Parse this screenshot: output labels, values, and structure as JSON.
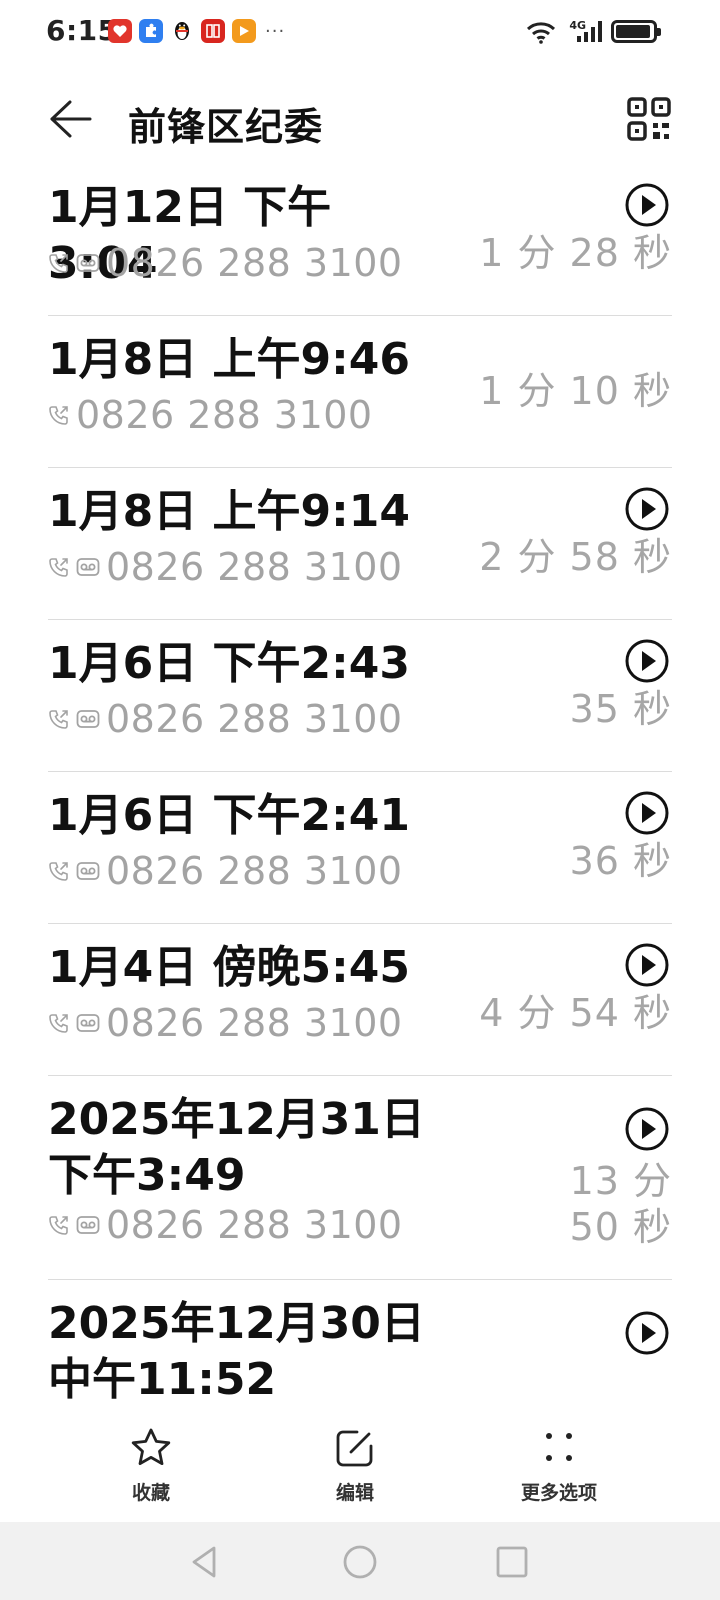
{
  "status_bar": {
    "time": "6:15",
    "network": "4G",
    "battery_level": 0.95,
    "notif_icons": [
      "health-app-icon",
      "puzzle-app-icon",
      "qq-penguin-icon",
      "news-app-icon",
      "video-app-icon"
    ],
    "more": "···"
  },
  "header": {
    "title": "前锋区纪委"
  },
  "calls": [
    {
      "date": "1月12日 下午3:04",
      "number": "0826 288 3100",
      "duration": "1 分 28 秒",
      "has_recording": true
    },
    {
      "date": "1月8日 上午9:46",
      "number": "0826 288 3100",
      "duration": "1 分 10 秒",
      "has_recording": false
    },
    {
      "date": "1月8日 上午9:14",
      "number": "0826 288 3100",
      "duration": "2 分 58 秒",
      "has_recording": true
    },
    {
      "date": "1月6日 下午2:43",
      "number": "0826 288 3100",
      "duration": "35 秒",
      "has_recording": true
    },
    {
      "date": "1月6日 下午2:41",
      "number": "0826 288 3100",
      "duration": "36 秒",
      "has_recording": true
    },
    {
      "date": "1月4日 傍晚5:45",
      "number": "0826 288 3100",
      "duration": "4 分 54 秒",
      "has_recording": true
    },
    {
      "date": "2025年12月31日 下午3:49",
      "number": "0826 288 3100",
      "duration": "13 分 50 秒",
      "has_recording": true
    },
    {
      "date": "2025年12月30日 中午11:52",
      "number": "",
      "duration": "",
      "has_recording": true
    }
  ],
  "toolbar": {
    "favorite_label": "收藏",
    "edit_label": "编辑",
    "more_label": "更多选项"
  },
  "colors": {
    "primary_text": "#111111",
    "secondary_text": "#a3a3a3",
    "divider": "#dcdcdc",
    "nav_bg": "#f1f1f1"
  }
}
